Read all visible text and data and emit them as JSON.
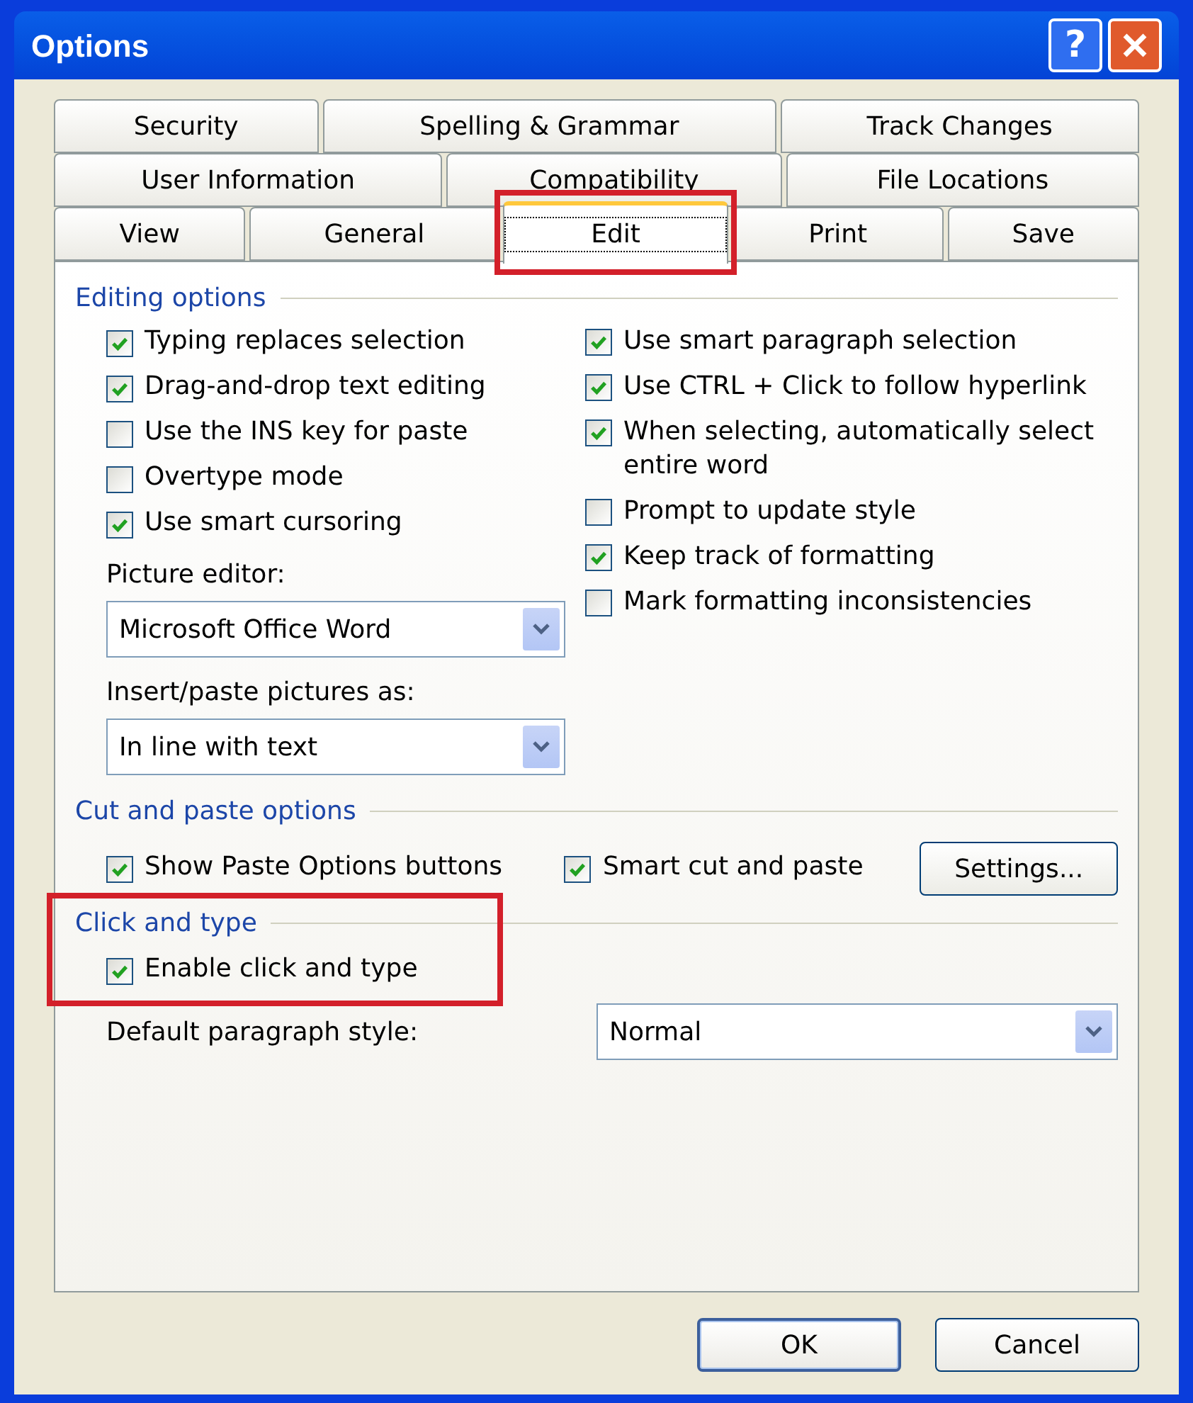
{
  "window": {
    "title": "Options",
    "title_buttons": [
      {
        "kind": "help",
        "label": "?"
      },
      {
        "kind": "close"
      }
    ]
  },
  "tab_rows": [
    [
      {
        "label": "Security",
        "selected": false
      },
      {
        "label": "Spelling & Grammar",
        "selected": false
      },
      {
        "label": "Track Changes",
        "selected": false
      }
    ],
    [
      {
        "label": "User Information",
        "selected": false
      },
      {
        "label": "Compatibility",
        "selected": false
      },
      {
        "label": "File Locations",
        "selected": false
      }
    ],
    [
      {
        "label": "View",
        "selected": false
      },
      {
        "label": "General",
        "selected": false
      },
      {
        "label": "Edit",
        "selected": true,
        "highlighted": true
      },
      {
        "label": "Print",
        "selected": false
      },
      {
        "label": "Save",
        "selected": false
      }
    ]
  ],
  "editing_options": {
    "title": "Editing options",
    "left": [
      {
        "kind": "checkbox",
        "label": "Typing replaces selection",
        "checked": true
      },
      {
        "kind": "checkbox",
        "label": "Drag-and-drop text editing",
        "checked": true
      },
      {
        "kind": "checkbox",
        "label": "Use the INS key for paste",
        "checked": false
      },
      {
        "kind": "checkbox",
        "label": "Overtype mode",
        "checked": false
      },
      {
        "kind": "checkbox",
        "label": "Use smart cursoring",
        "checked": true
      },
      {
        "kind": "label",
        "label": "Picture editor:"
      },
      {
        "kind": "dropdown",
        "value": "Microsoft Office Word"
      },
      {
        "kind": "label",
        "label": "Insert/paste pictures as:"
      },
      {
        "kind": "dropdown",
        "value": "In line with text"
      }
    ],
    "right": [
      {
        "label": "Use smart paragraph selection",
        "checked": true
      },
      {
        "label": "Use CTRL + Click to follow hyperlink",
        "checked": true
      },
      {
        "label": "When selecting, automatically select entire word",
        "checked": true
      },
      {
        "label": "Prompt to update style",
        "checked": false
      },
      {
        "label": "Keep track of formatting",
        "checked": true
      },
      {
        "label": "Mark formatting inconsistencies",
        "checked": false
      }
    ]
  },
  "cut_and_paste": {
    "title": "Cut and paste options",
    "checkboxes": [
      {
        "label": "Show Paste Options buttons",
        "checked": true
      },
      {
        "label": "Smart cut and paste",
        "checked": true
      }
    ],
    "button": "Settings..."
  },
  "click_and_type": {
    "title": "Click and type",
    "highlighted": true,
    "checkbox": {
      "label": "Enable click and type",
      "checked": true
    },
    "style_label": "Default paragraph style:",
    "style_value": "Normal"
  },
  "buttons": [
    {
      "label": "OK",
      "default": true
    },
    {
      "label": "Cancel",
      "default": false
    }
  ]
}
